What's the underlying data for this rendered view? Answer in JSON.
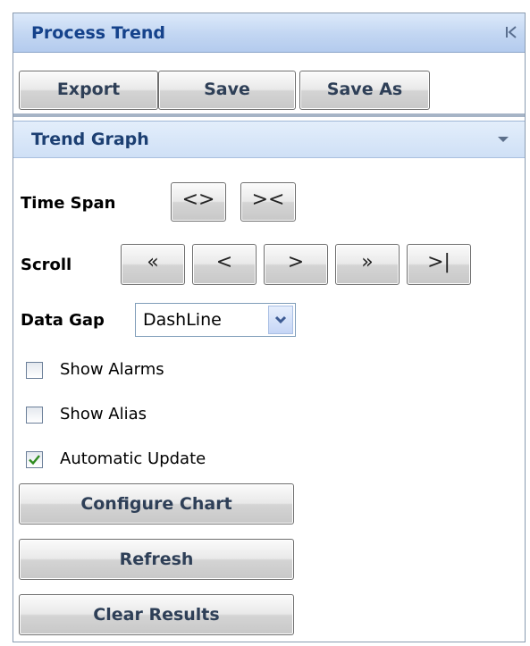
{
  "panel": {
    "title": "Process Trend",
    "collapse_icon": "collapse-left-icon"
  },
  "toolbar": {
    "export_label": "Export",
    "save_label": "Save",
    "save_as_label": "Save As"
  },
  "section": {
    "title": "Trend Graph",
    "toggle_icon": "chevron-down-icon"
  },
  "time_span": {
    "label": "Time Span",
    "expand_symbol": "<>",
    "contract_symbol": "><"
  },
  "scroll": {
    "label": "Scroll",
    "first_symbol": "«",
    "prev_symbol": "<",
    "next_symbol": ">",
    "last_symbol": "»",
    "end_symbol": ">|"
  },
  "data_gap": {
    "label": "Data Gap",
    "selected": "DashLine"
  },
  "options": [
    {
      "label": "Show Alarms",
      "checked": false
    },
    {
      "label": "Show Alias",
      "checked": false
    },
    {
      "label": "Automatic Update",
      "checked": true
    }
  ],
  "actions": {
    "configure_chart_label": "Configure Chart",
    "refresh_label": "Refresh",
    "clear_results_label": "Clear Results"
  },
  "colors": {
    "header_text": "#15428b",
    "check_mark": "#2e8b1f",
    "button_text": "#2e3f57"
  }
}
